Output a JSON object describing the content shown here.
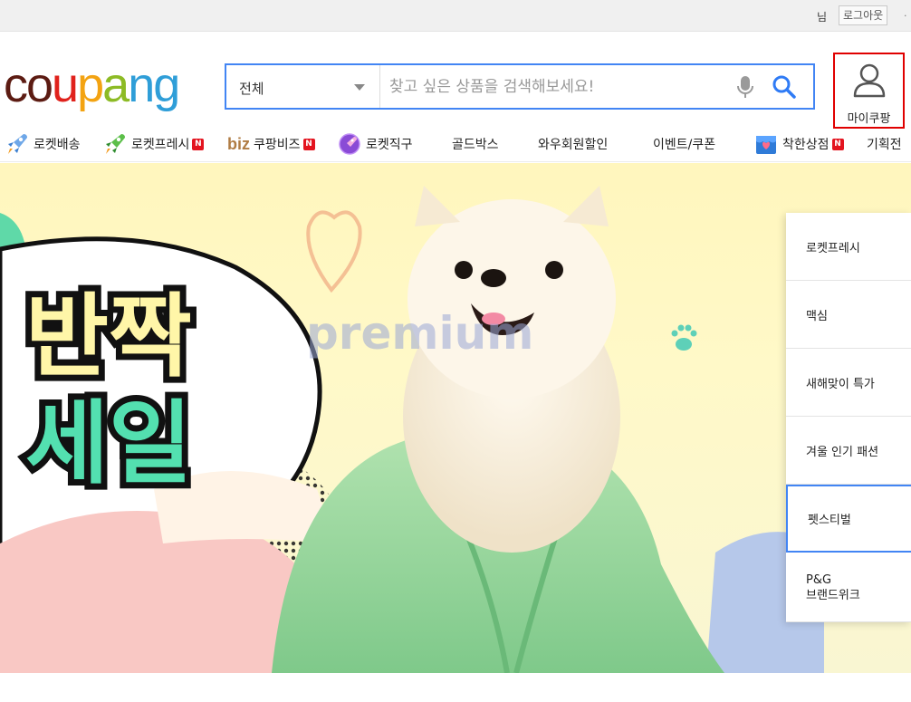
{
  "topbar": {
    "user_suffix": "님",
    "logout_label": "로그아웃"
  },
  "header": {
    "logo_letters": [
      "c",
      "o",
      "u",
      "p",
      "a",
      "n",
      "g"
    ],
    "search": {
      "category": "전체",
      "placeholder": "찾고 싶은 상품을 검색해보세요!"
    },
    "mycoupang_label": "마이쿠팡"
  },
  "nav": {
    "items": [
      {
        "label": "로켓배송",
        "icon": "rocket-icon",
        "new": false
      },
      {
        "label": "로켓프레시",
        "icon": "rocket-fresh-icon",
        "new": true
      },
      {
        "label": "쿠팡비즈",
        "icon": "biz-logo",
        "prefix": "biz",
        "new": true
      },
      {
        "label": "로켓직구",
        "icon": "globe-rocket-icon",
        "new": false
      },
      {
        "label": "골드박스",
        "new": false
      },
      {
        "label": "와우회원할인",
        "new": false
      },
      {
        "label": "이벤트/쿠폰",
        "new": false
      },
      {
        "label": "착한상점",
        "icon": "store-icon",
        "new": true
      },
      {
        "label": "기획전",
        "new": false
      }
    ],
    "new_badge": "N"
  },
  "banner": {
    "headline_line1": "반짝",
    "headline_line2": "세일",
    "watermark": "premium"
  },
  "side_menu": {
    "items": [
      {
        "label": "로켓프레시"
      },
      {
        "label": "맥심"
      },
      {
        "label": "새해맞이 특가"
      },
      {
        "label": "겨울 인기 패션"
      },
      {
        "label": "펫스티벌",
        "active": true
      },
      {
        "label_line1": "P&G",
        "label_line2": "브랜드위크"
      }
    ]
  },
  "colors": {
    "accent": "#4285f4",
    "highlight_border": "#e00000",
    "new_badge": "#e3141f"
  }
}
